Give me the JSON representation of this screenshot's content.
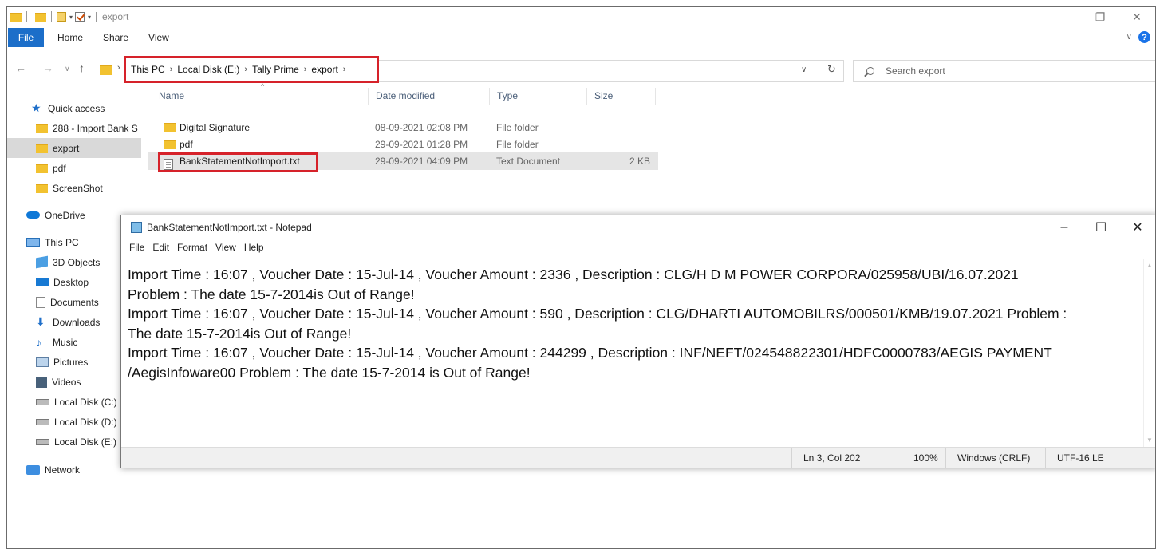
{
  "explorer": {
    "title": "export",
    "ribbon_tabs": [
      "File",
      "Home",
      "Share",
      "View"
    ],
    "breadcrumb": [
      "This PC",
      "Local Disk (E:)",
      "Tally Prime",
      "export"
    ],
    "search_placeholder": "Search export",
    "sidebar": {
      "items": [
        {
          "label": "Quick access",
          "icon": "star-icon"
        },
        {
          "label": "288 - Import Bank S",
          "icon": "folder-icon"
        },
        {
          "label": "export",
          "icon": "folder-icon",
          "selected": true
        },
        {
          "label": "pdf",
          "icon": "folder-icon"
        },
        {
          "label": "ScreenShot",
          "icon": "folder-icon"
        },
        {
          "label": "OneDrive",
          "icon": "cloud-icon"
        },
        {
          "label": "This PC",
          "icon": "pc-icon"
        },
        {
          "label": "3D Objects",
          "icon": "cube-icon"
        },
        {
          "label": "Desktop",
          "icon": "desktop-icon"
        },
        {
          "label": "Documents",
          "icon": "documents-icon"
        },
        {
          "label": "Downloads",
          "icon": "download-icon"
        },
        {
          "label": "Music",
          "icon": "music-icon"
        },
        {
          "label": "Pictures",
          "icon": "pictures-icon"
        },
        {
          "label": "Videos",
          "icon": "videos-icon"
        },
        {
          "label": "Local Disk (C:)",
          "icon": "disk-icon"
        },
        {
          "label": "Local Disk (D:)",
          "icon": "disk-icon"
        },
        {
          "label": "Local Disk (E:)",
          "icon": "disk-icon"
        },
        {
          "label": "Network",
          "icon": "network-icon"
        }
      ]
    },
    "columns": [
      "Name",
      "Date modified",
      "Type",
      "Size"
    ],
    "files": [
      {
        "name": "Digital Signature",
        "date": "08-09-2021 02:08 PM",
        "type": "File folder",
        "size": "",
        "icon": "folder-icon"
      },
      {
        "name": "pdf",
        "date": "29-09-2021 01:28 PM",
        "type": "File folder",
        "size": "",
        "icon": "folder-icon"
      },
      {
        "name": "BankStatementNotImport.txt",
        "date": "29-09-2021 04:09 PM",
        "type": "Text Document",
        "size": "2 KB",
        "icon": "text-file-icon",
        "selected": true
      }
    ]
  },
  "notepad": {
    "title": "BankStatementNotImport.txt - Notepad",
    "menu": [
      "File",
      "Edit",
      "Format",
      "View",
      "Help"
    ],
    "lines": [
      "Import Time : 16:07 , Voucher Date : 15-Jul-14 , Voucher Amount : 2336 , Description : CLG/H  D  M  POWER  CORPORA/025958/UBI/16.07.2021",
      "Problem : The date 15-7-2014is Out of Range!",
      "Import Time : 16:07 , Voucher Date : 15-Jul-14 , Voucher Amount : 590 , Description : CLG/DHARTI AUTOMOBILRS/000501/KMB/19.07.2021  Problem :",
      "The date 15-7-2014is Out of Range!",
      "Import Time : 16:07 , Voucher Date : 15-Jul-14 , Voucher Amount : 244299 , Description : INF/NEFT/024548822301/HDFC0000783/AEGIS PAYMENT",
      "/AegisInfoware00  Problem : The date 15-7-2014 is Out of Range!"
    ],
    "status": {
      "position": "Ln 3, Col 202",
      "zoom": "100%",
      "line_ending": "Windows (CRLF)",
      "encoding": "UTF-16 LE"
    }
  },
  "colors": {
    "highlight_border": "#d6222a",
    "file_tab": "#1c6ec9",
    "folder": "#f2c230"
  }
}
